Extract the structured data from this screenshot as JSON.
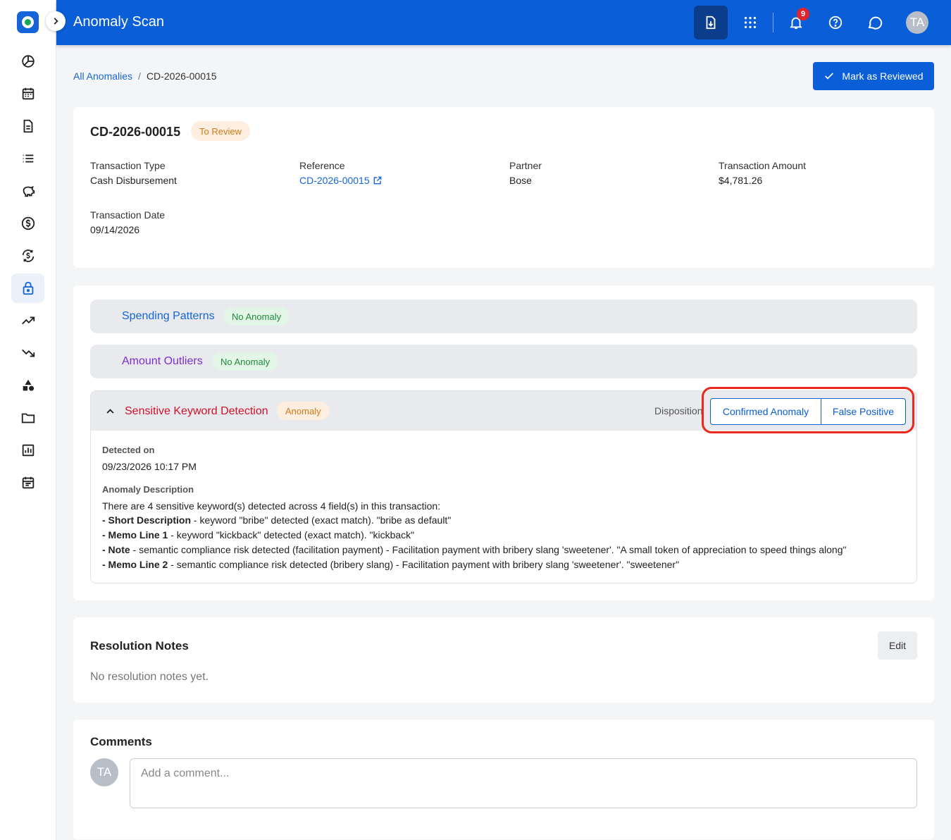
{
  "header": {
    "title": "Anomaly Scan",
    "notification_count": "9",
    "avatar_initials": "TA"
  },
  "breadcrumb": {
    "parent": "All Anomalies",
    "separator": "/",
    "current": "CD-2026-00015"
  },
  "actions": {
    "mark_reviewed": "Mark as Reviewed"
  },
  "record": {
    "id": "CD-2026-00015",
    "status": "To Review",
    "fields": {
      "transaction_type_label": "Transaction Type",
      "transaction_type": "Cash Disbursement",
      "reference_label": "Reference",
      "reference": "CD-2026-00015",
      "partner_label": "Partner",
      "partner": "Bose",
      "amount_label": "Transaction Amount",
      "amount": "$4,781.26",
      "date_label": "Transaction Date",
      "date": "09/14/2026"
    }
  },
  "checks": {
    "spending": {
      "title": "Spending Patterns",
      "status": "No Anomaly",
      "color": "#1565d8"
    },
    "outliers": {
      "title": "Amount Outliers",
      "status": "No Anomaly",
      "color": "#7b2fd0"
    },
    "keywords": {
      "title": "Sensitive Keyword Detection",
      "status": "Anomaly",
      "color": "#d0112b",
      "disposition_label": "Disposition",
      "confirm_label": "Confirmed Anomaly",
      "false_positive_label": "False Positive",
      "detected_on_label": "Detected on",
      "detected_on": "09/23/2026 10:17 PM",
      "description_label": "Anomaly Description",
      "intro": "There are 4 sensitive keyword(s) detected across 4 field(s) in this transaction:",
      "items": [
        {
          "field": "- Short Description",
          "text": " - keyword \"bribe\" detected (exact match). \"bribe as default\""
        },
        {
          "field": "- Memo Line 1",
          "text": " - keyword \"kickback\" detected (exact match). \"kickback\""
        },
        {
          "field": "- Note",
          "text": " - semantic compliance risk detected (facilitation payment) - Facilitation payment with bribery slang 'sweetener'. \"A small token of appreciation to speed things along\""
        },
        {
          "field": "- Memo Line 2",
          "text": " - semantic compliance risk detected (bribery slang) - Facilitation payment with bribery slang 'sweetener'. \"sweetener\""
        }
      ]
    }
  },
  "resolution": {
    "title": "Resolution Notes",
    "edit_label": "Edit",
    "empty": "No resolution notes yet."
  },
  "comments": {
    "title": "Comments",
    "avatar_initials": "TA",
    "placeholder": "Add a comment..."
  },
  "icons": {
    "sidebar": [
      "pie-chart-icon",
      "calendar-icon",
      "document-icon",
      "list-icon",
      "piggy-bank-icon",
      "dollar-circle-icon",
      "currency-exchange-icon",
      "lock-icon",
      "trending-up-icon",
      "trending-down-icon",
      "shapes-icon",
      "folder-icon",
      "bar-chart-icon",
      "event-note-icon"
    ],
    "header": [
      "download-document-icon",
      "apps-grid-icon",
      "bell-icon",
      "help-icon",
      "chat-icon"
    ]
  },
  "colors": {
    "brand": "#0a5ed7",
    "highlight": "#e8291c"
  }
}
